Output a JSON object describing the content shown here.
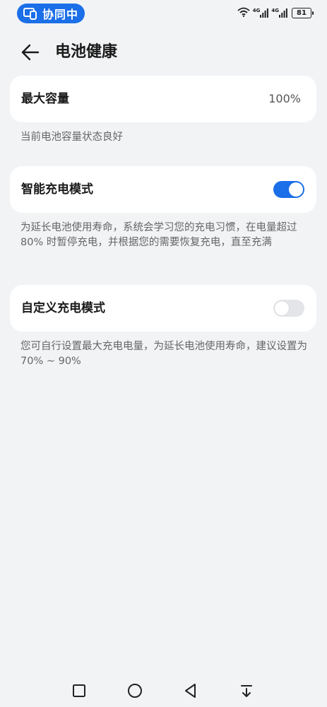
{
  "status_bar": {
    "collab_label": "协同中",
    "network_1": "4G",
    "network_2": "4G",
    "battery_level": "81"
  },
  "header": {
    "title": "电池健康"
  },
  "max_capacity": {
    "label": "最大容量",
    "value": "100%",
    "description": "当前电池容量状态良好"
  },
  "smart_charging": {
    "label": "智能充电模式",
    "enabled": true,
    "description": "为延长电池使用寿命，系统会学习您的充电习惯，在电量超过 80% 时暂停充电，并根据您的需要恢复充电，直至充满"
  },
  "custom_charging": {
    "label": "自定义充电模式",
    "enabled": false,
    "description": "您可自行设置最大充电电量，为延长电池使用寿命，建议设置为 70% ~ 90%"
  },
  "colors": {
    "accent": "#1b6fe8",
    "background": "#f1f3f5",
    "card": "#ffffff"
  },
  "icons": [
    "collab-icon",
    "wifi-icon",
    "signal-icon",
    "battery-icon",
    "back-arrow-icon",
    "recent-apps-icon",
    "home-icon",
    "back-nav-icon",
    "notification-drawer-icon"
  ]
}
